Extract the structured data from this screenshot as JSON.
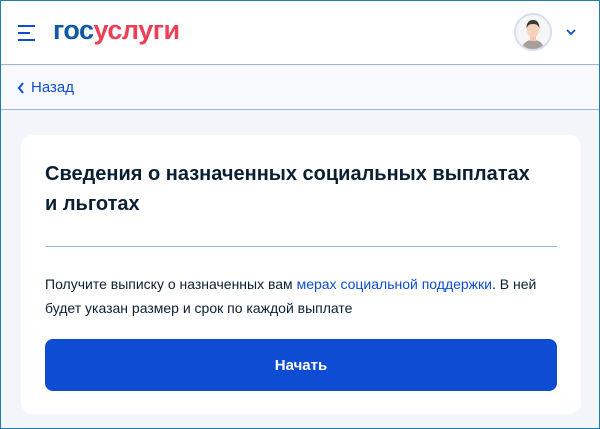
{
  "header": {
    "logo_part1": "гос",
    "logo_part2": "услуги"
  },
  "nav": {
    "back_label": "Назад"
  },
  "card": {
    "title": "Сведения о назначенных социальных выплатах и льготах",
    "desc_before": "Получите выписку о назначенных вам ",
    "desc_link": "мерах социальной поддержки",
    "desc_after": ". В ней будет указан размер и срок по каждой выплате",
    "start_label": "Начать"
  },
  "colors": {
    "accent": "#0d4cd3",
    "logo_blue": "#0d5aa7",
    "logo_red": "#ee3f58"
  }
}
